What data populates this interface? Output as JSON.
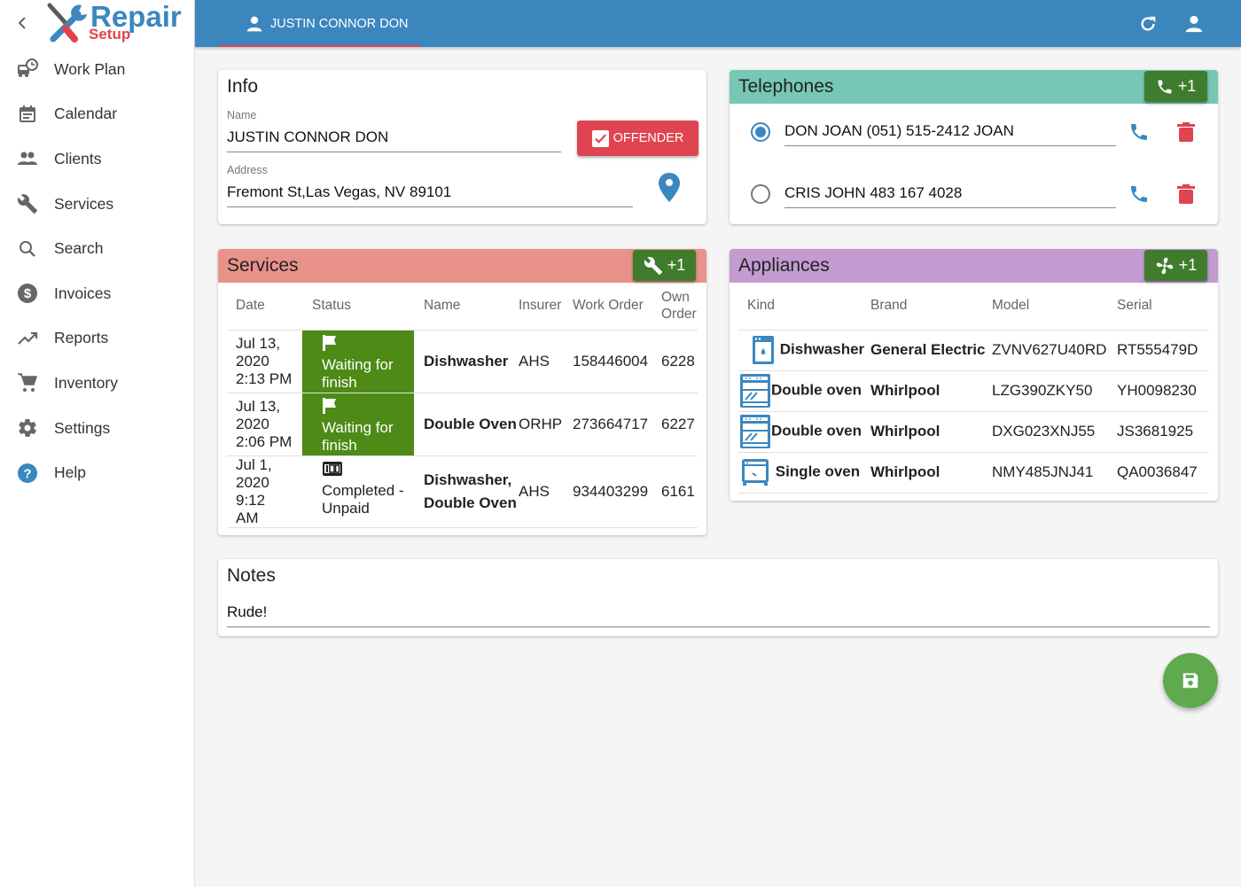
{
  "app": {
    "logo_primary": "Repair",
    "logo_secondary": "Setup"
  },
  "sidebar": {
    "items": [
      {
        "label": "Work Plan",
        "icon": "truck-clock-icon"
      },
      {
        "label": "Calendar",
        "icon": "calendar-icon"
      },
      {
        "label": "Clients",
        "icon": "people-icon"
      },
      {
        "label": "Services",
        "icon": "wrench-icon"
      },
      {
        "label": "Search",
        "icon": "search-icon"
      },
      {
        "label": "Invoices",
        "icon": "dollar-circle-icon"
      },
      {
        "label": "Reports",
        "icon": "trending-up-icon"
      },
      {
        "label": "Inventory",
        "icon": "cart-icon"
      },
      {
        "label": "Settings",
        "icon": "gear-icon"
      },
      {
        "label": "Help",
        "icon": "help-circle-icon"
      }
    ]
  },
  "topbar": {
    "tab_label": "JUSTIN CONNOR DON",
    "accent": "#3b87bd"
  },
  "info": {
    "title": "Info",
    "name_label": "Name",
    "name_value": "JUSTIN CONNOR DON",
    "address_label": "Address",
    "address_value": "Fremont St,Las Vegas, NV 89101",
    "offender_label": "OFFENDER",
    "offender_checked": true
  },
  "telephones": {
    "title": "Telephones",
    "add_label": "+1",
    "items": [
      {
        "value": "DON JOAN (051) 515-2412 JOAN",
        "selected": true
      },
      {
        "value": "CRIS JOHN 483 167 4028",
        "selected": false
      }
    ]
  },
  "services": {
    "title": "Services",
    "add_label": "+1",
    "columns": [
      "Date",
      "Status",
      "Name",
      "Insurer",
      "Work Order",
      "Own Order"
    ],
    "rows": [
      {
        "date": "Jul 13, 2020 2:13 PM",
        "status": "Waiting for finish",
        "status_icon": "flag-icon",
        "name": "Dishwasher",
        "insurer": "AHS",
        "work_order": "158446004",
        "own_order": "6228"
      },
      {
        "date": "Jul 13, 2020 2:06 PM",
        "status": "Waiting for finish",
        "status_icon": "flag-icon",
        "name": "Double Oven",
        "insurer": "ORHP",
        "work_order": "273664717",
        "own_order": "6227"
      },
      {
        "date": "Jul 1, 2020 9:12 AM",
        "status": "Completed - Unpaid",
        "status_icon": "counter-100-icon",
        "name": "Dishwasher, Double Oven",
        "insurer": "AHS",
        "work_order": "934403299",
        "own_order": "6161"
      }
    ]
  },
  "appliances": {
    "title": "Appliances",
    "add_label": "+1",
    "columns": [
      "Kind",
      "Brand",
      "Model",
      "Serial"
    ],
    "rows": [
      {
        "kind": "Dishwasher",
        "icon": "dishwasher-icon",
        "brand": "General Electric",
        "model": "ZVNV627U40RD",
        "serial": "RT555479D"
      },
      {
        "kind": "Double oven",
        "icon": "double-oven-icon",
        "brand": "Whirlpool",
        "model": "LZG390ZKY50",
        "serial": "YH0098230"
      },
      {
        "kind": "Double oven",
        "icon": "double-oven-icon",
        "brand": "Whirlpool",
        "model": "DXG023XNJ55",
        "serial": "JS3681925"
      },
      {
        "kind": "Single oven",
        "icon": "single-oven-icon",
        "brand": "Whirlpool",
        "model": "NMY485JNJ41",
        "serial": "QA0036847"
      }
    ]
  },
  "notes": {
    "title": "Notes",
    "value": "Rude!"
  },
  "colors": {
    "telephones_header": "#77c7b5",
    "services_header": "#e8928a",
    "appliances_header": "#c39bd1",
    "add_button": "#3f7c2d",
    "status_green": "#4d8a16",
    "offender": "#e04450",
    "fab": "#5fa94e"
  }
}
